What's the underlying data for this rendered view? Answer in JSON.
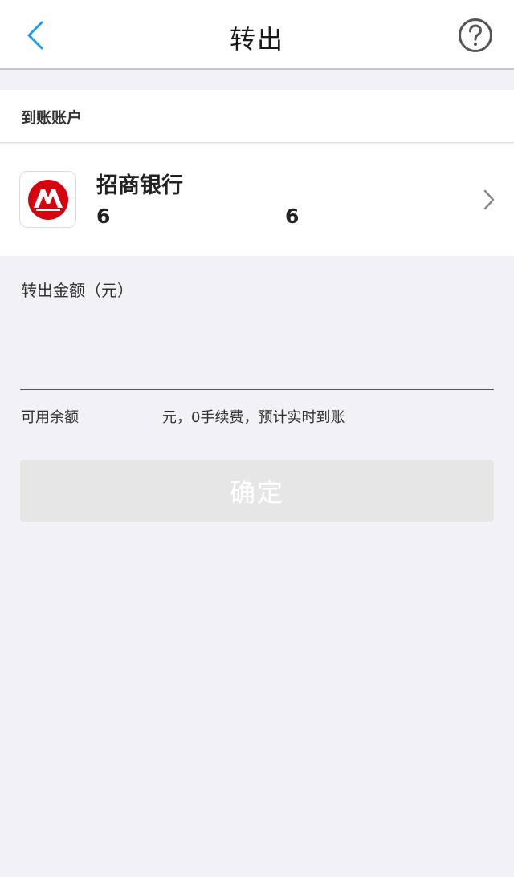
{
  "nav": {
    "title": "转出",
    "back_icon": "chevron-left-icon",
    "help_icon": "question-circle-icon"
  },
  "section": {
    "title": "到账账户"
  },
  "bank": {
    "name": "招商银行",
    "card_prefix": "6",
    "card_suffix": "6",
    "logo_icon": "cmb-logo-icon",
    "logo_color": "#d7000f"
  },
  "amount": {
    "label": "转出金额（元）",
    "value": ""
  },
  "balance": {
    "label": "可用余额",
    "suffix": "元，0手续费，预计实时到账"
  },
  "confirm": {
    "label": "确定"
  },
  "colors": {
    "accent": "#1e9be9",
    "background": "#f2f2f6",
    "button_disabled": "#e6e6e6"
  }
}
